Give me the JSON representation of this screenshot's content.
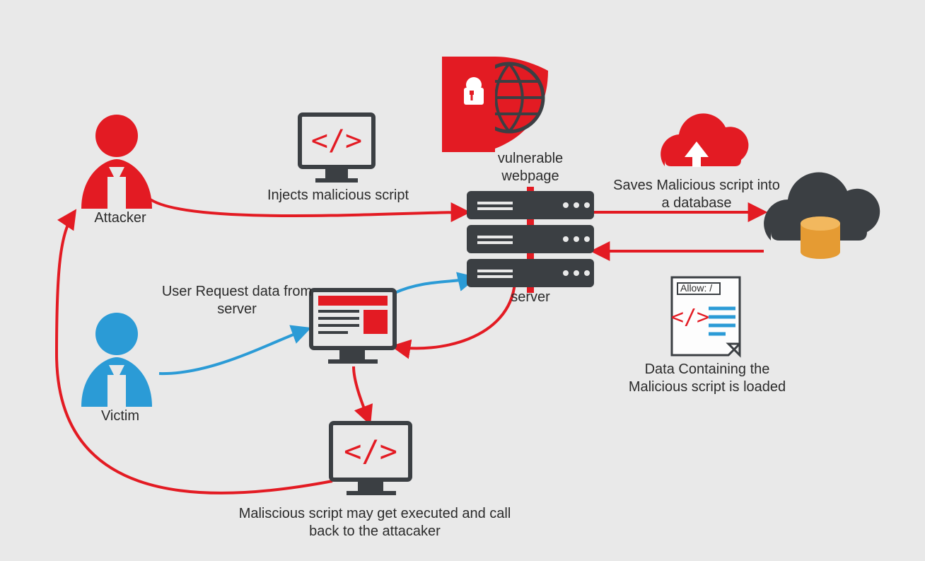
{
  "colors": {
    "red": "#e31b23",
    "blue": "#2b9bd6",
    "dark": "#3b3f43",
    "orange": "#e59b33",
    "bg": "#e9e9e9",
    "text": "#2b2b2b"
  },
  "nodes": {
    "attacker": "Attacker",
    "victim": "Victim",
    "inject_script": "Injects malicious script",
    "vuln_page": "vulnerable webpage",
    "server": "server",
    "save_db": "Saves Malicious script into a database",
    "data_loaded": "Data Containing the Malicious script is loaded",
    "user_request": "User Request data from server",
    "callback": "Maliscious script may get executed and call back to the attacaker",
    "allow_tag": "Allow: /"
  },
  "edges": [
    {
      "id": "attacker_to_server",
      "from": "attacker",
      "to": "server",
      "color": "red"
    },
    {
      "id": "server_to_db",
      "from": "server",
      "to": "database",
      "color": "red"
    },
    {
      "id": "db_to_server",
      "from": "database",
      "to": "server",
      "color": "red"
    },
    {
      "id": "victim_to_browser",
      "from": "victim",
      "to": "browser",
      "color": "blue"
    },
    {
      "id": "browser_to_server",
      "from": "browser",
      "to": "server",
      "color": "blue"
    },
    {
      "id": "server_to_browser",
      "from": "server",
      "to": "browser",
      "color": "red"
    },
    {
      "id": "browser_to_script",
      "from": "browser",
      "to": "malicious_script",
      "color": "red"
    },
    {
      "id": "script_to_attacker",
      "from": "malicious_script",
      "to": "attacker",
      "color": "red"
    }
  ]
}
